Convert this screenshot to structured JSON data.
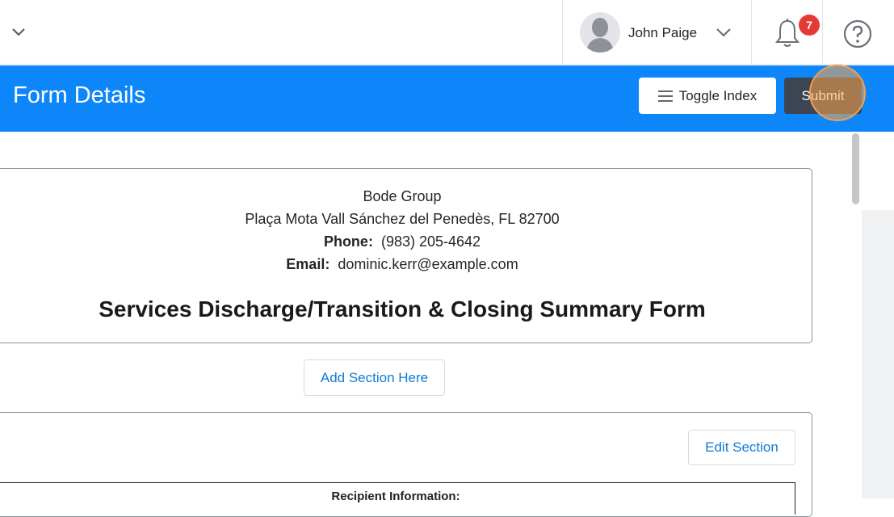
{
  "topbar": {
    "user_name": "John Paige",
    "notification_count": "7"
  },
  "header": {
    "title": "Form Details",
    "toggle_index_label": "Toggle Index",
    "submit_label": "Submit"
  },
  "form_header": {
    "organization": "Bode Group",
    "address": "Plaça Mota Vall Sánchez del Penedès, FL 82700",
    "phone_label": "Phone:",
    "phone": "(983) 205-4642",
    "email_label": "Email:",
    "email": "dominic.kerr@example.com",
    "form_title": "Services Discharge/Transition & Closing Summary Form"
  },
  "actions": {
    "add_section_label": "Add Section Here",
    "edit_section_label": "Edit Section"
  },
  "section": {
    "table_heading": "Recipient Information:"
  },
  "colors": {
    "header_blue": "#0d86f9",
    "submit_bg": "#3d4452",
    "link_blue": "#0d7bd6",
    "badge_red": "#e53935",
    "focus_orange": "#f0a050"
  },
  "icons": [
    "chevron-down-icon",
    "avatar",
    "bell-icon",
    "help-icon",
    "hamburger-icon"
  ]
}
